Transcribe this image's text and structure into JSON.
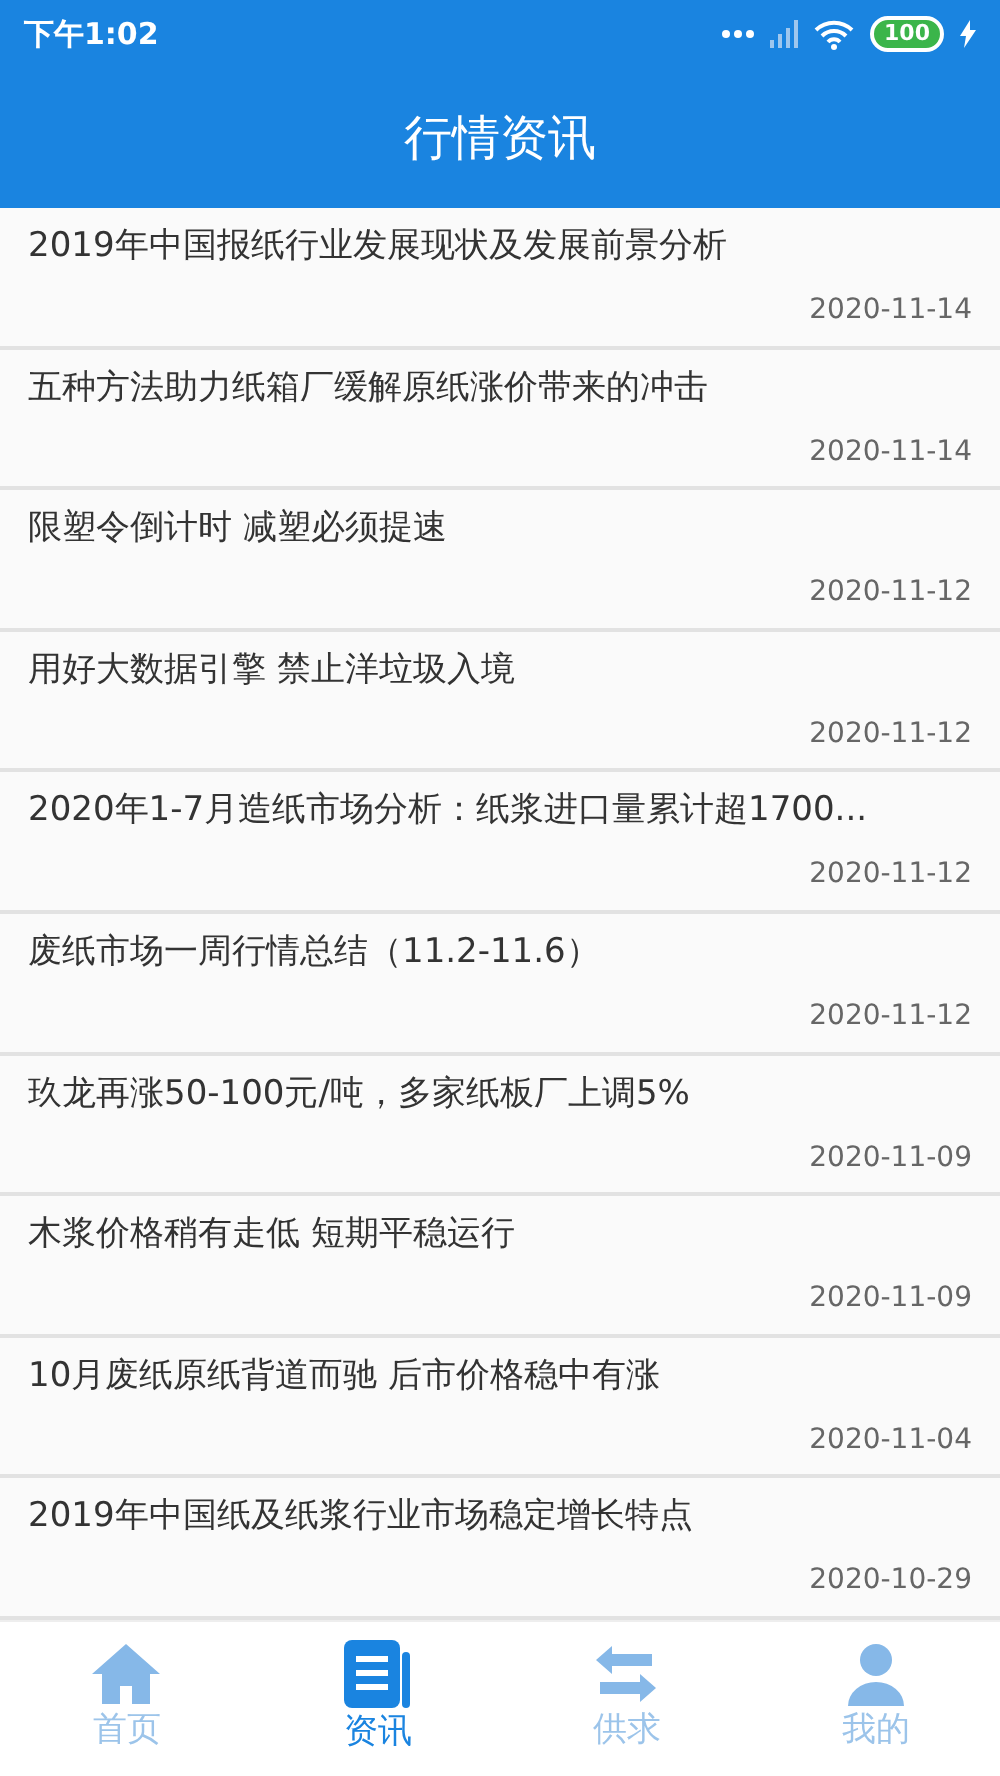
{
  "status_bar": {
    "time": "下午1:02",
    "battery": "100"
  },
  "header": {
    "title": "行情资讯"
  },
  "news": [
    {
      "title": "2019年中国报纸行业发展现状及发展前景分析",
      "date": "2020-11-14"
    },
    {
      "title": "五种方法助力纸箱厂缓解原纸涨价带来的冲击",
      "date": "2020-11-14"
    },
    {
      "title": "限塑令倒计时 减塑必须提速",
      "date": "2020-11-12"
    },
    {
      "title": "用好大数据引擎 禁止洋垃圾入境",
      "date": "2020-11-12"
    },
    {
      "title": "2020年1-7月造纸市场分析：纸浆进口量累计超1700...",
      "date": "2020-11-12"
    },
    {
      "title": "废纸市场一周行情总结（11.2-11.6）",
      "date": "2020-11-12"
    },
    {
      "title": "玖龙再涨50-100元/吨，多家纸板厂上调5%",
      "date": "2020-11-09"
    },
    {
      "title": "木浆价格稍有走低 短期平稳运行",
      "date": "2020-11-09"
    },
    {
      "title": "10月废纸原纸背道而驰 后市价格稳中有涨",
      "date": "2020-11-04"
    },
    {
      "title": "2019年中国纸及纸浆行业市场稳定增长特点",
      "date": "2020-10-29"
    }
  ],
  "tabs": [
    {
      "label": "首页",
      "kind": "home",
      "selected": false
    },
    {
      "label": "资讯",
      "kind": "news",
      "selected": true
    },
    {
      "label": "供求",
      "kind": "trade",
      "selected": false
    },
    {
      "label": "我的",
      "kind": "profile",
      "selected": false
    }
  ]
}
